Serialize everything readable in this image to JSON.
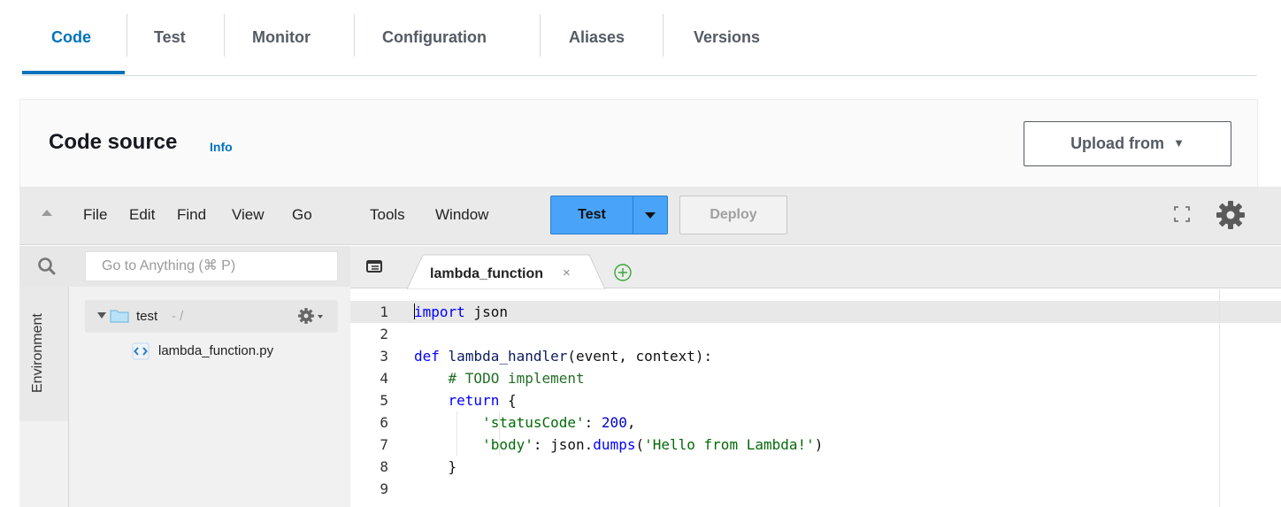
{
  "tabs": [
    {
      "label": "Code",
      "active": true
    },
    {
      "label": "Test",
      "active": false
    },
    {
      "label": "Monitor",
      "active": false
    },
    {
      "label": "Configuration",
      "active": false
    },
    {
      "label": "Aliases",
      "active": false
    },
    {
      "label": "Versions",
      "active": false
    }
  ],
  "panel": {
    "title": "Code source",
    "info_link": "Info",
    "upload_label": "Upload from",
    "upload_caret": "▼"
  },
  "menubar": {
    "items": [
      "File",
      "Edit",
      "Find",
      "View",
      "Go",
      "Tools",
      "Window"
    ],
    "test_label": "Test",
    "deploy_label": "Deploy"
  },
  "file_browser": {
    "search_placeholder": "Go to Anything (⌘ P)",
    "environment_label": "Environment",
    "folder_name": "test",
    "folder_path": "- /",
    "file_name": "lambda_function.py"
  },
  "editor": {
    "tab_label": "lambda_function",
    "tab_close": "×",
    "highlighted_line": 1,
    "line_numbers": [
      "1",
      "2",
      "3",
      "4",
      "5",
      "6",
      "7",
      "8",
      "9"
    ]
  },
  "colors": {
    "accent": "#0073bb",
    "test_button": "#49a3f8",
    "keyword": "#0000ff",
    "comment": "#236e25",
    "string": "#036a07"
  },
  "icons": {
    "collapse": "triangle-up-icon",
    "fullscreen": "fullscreen-icon",
    "settings": "gear-icon",
    "search": "search-icon",
    "folder": "folder-icon",
    "python_file": "python-file-icon",
    "add_tab": "plus-circle-icon",
    "tabs_menu": "tabs-menu-icon"
  }
}
